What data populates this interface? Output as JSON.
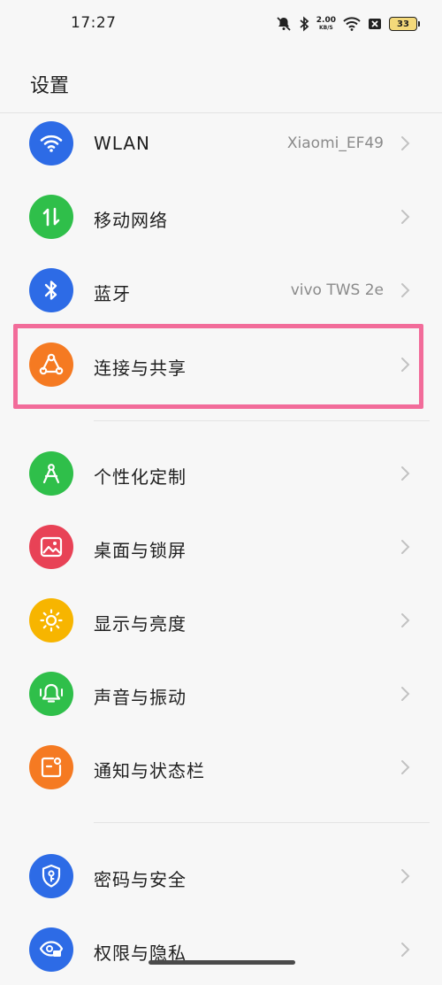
{
  "status_bar": {
    "time": "17:27",
    "net_speed_value": "2.00",
    "net_speed_unit": "KB/S",
    "battery_level": "33",
    "icons": [
      "mute-bell-icon",
      "bluetooth-icon",
      "wifi-icon",
      "sim-none-icon",
      "battery-icon"
    ]
  },
  "header": {
    "title": "设置"
  },
  "settings": {
    "items": [
      {
        "label": "WLAN",
        "value": "Xiaomi_EF49",
        "icon": "wifi-icon",
        "color": "#2d6be6"
      },
      {
        "label": "移动网络",
        "value": "",
        "icon": "mobile-data-icon",
        "color": "#2fbf4a"
      },
      {
        "label": "蓝牙",
        "value": "vivo TWS 2e",
        "icon": "bluetooth-icon",
        "color": "#2d6be6"
      },
      {
        "label": "连接与共享",
        "value": "",
        "icon": "share-connection-icon",
        "color": "#f57a22"
      },
      {
        "label": "个性化定制",
        "value": "",
        "icon": "compass-icon",
        "color": "#2fbf4a"
      },
      {
        "label": "桌面与锁屏",
        "value": "",
        "icon": "picture-icon",
        "color": "#e84256"
      },
      {
        "label": "显示与亮度",
        "value": "",
        "icon": "sun-icon",
        "color": "#f7b500"
      },
      {
        "label": "声音与振动",
        "value": "",
        "icon": "bell-vibrate-icon",
        "color": "#2fbf4a"
      },
      {
        "label": "通知与状态栏",
        "value": "",
        "icon": "notification-icon",
        "color": "#f57a22"
      },
      {
        "label": "密码与安全",
        "value": "",
        "icon": "shield-key-icon",
        "color": "#2d6be6"
      },
      {
        "label": "权限与隐私",
        "value": "",
        "icon": "eye-lock-icon",
        "color": "#2d6be6"
      }
    ]
  },
  "highlight_color": "#f26c9a"
}
